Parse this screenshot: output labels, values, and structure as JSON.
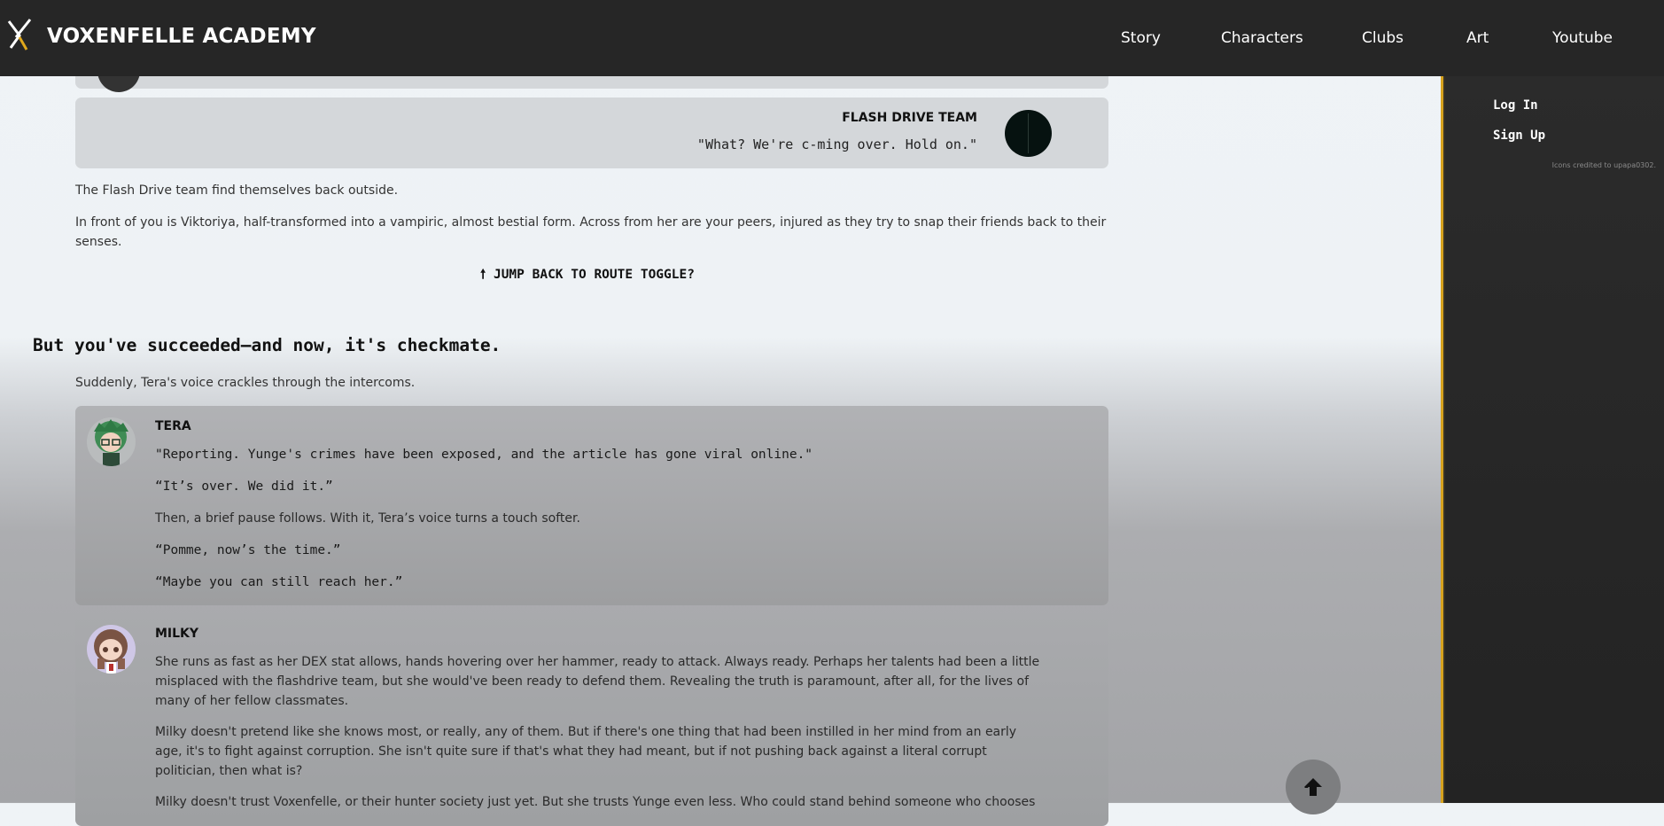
{
  "header": {
    "title": "VOXENFELLE ACADEMY",
    "nav": [
      {
        "label": "Story"
      },
      {
        "label": "Characters"
      },
      {
        "label": "Clubs"
      },
      {
        "label": "Art"
      },
      {
        "label": "Youtube"
      }
    ]
  },
  "sidebar": {
    "login": "Log In",
    "signup": "Sign Up",
    "credits": "Icons credited to upapa0302."
  },
  "flash_card": {
    "name": "FLASH DRIVE TEAM",
    "quote": "\"What? We're c-ming over. Hold on.\""
  },
  "narration": {
    "p1": "The Flash Drive team find themselves back outside.",
    "p2a": "In front of you is Viktoriya, half-transformed into a vampiric, almost bestial form. Across from her are your peers, injured as they try to snap their friends back to their",
    "p2b": "senses."
  },
  "jump_link": "JUMP BACK TO ROUTE TOGGLE?",
  "section": {
    "title": "But you've succeeded—and now, it's checkmate.",
    "intro": "Suddenly, Tera's voice crackles through the intercoms."
  },
  "tera": {
    "name": "TERA",
    "lines": [
      "\"Reporting. Yunge's crimes have been exposed, and the article has gone viral online.\"",
      "“It’s over. We did it.”",
      "Then, a brief pause follows. With it, Tera’s voice turns a touch softer.",
      "“Pomme, now’s the time.”",
      "“Maybe you can still reach her.”"
    ]
  },
  "milky": {
    "name": "MILKY",
    "paras": [
      "She runs as fast as her DEX stat allows, hands hovering over her hammer, ready to attack. Always ready. Perhaps her talents had been a little misplaced with the flashdrive team, but she would've been ready to defend them. Revealing the truth is paramount, after all, for the lives of many of her fellow classmates.",
      "Milky doesn't pretend like she knows most, or really, any of them. But if there's one thing that had been instilled in her mind from an early age, it's to fight against corruption. She isn't quite sure if that's what they had meant, but if not pushing back against a literal corrupt politician, then what is?",
      "Milky doesn't trust Voxenfelle, or their hunter society just yet. But she trusts Yunge even less. Who could stand behind someone who chooses"
    ]
  },
  "colors": {
    "navbar": "#262626",
    "sidebar_accent": "#d6a21e",
    "card": "#d4d7da"
  }
}
